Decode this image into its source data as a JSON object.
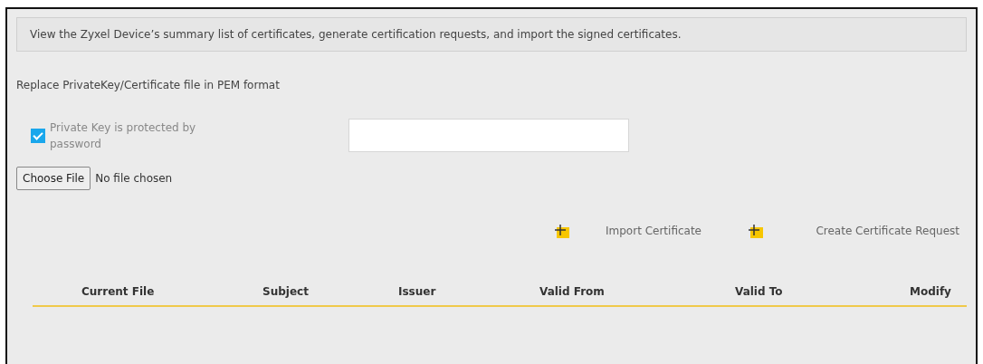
{
  "description": "View the Zyxel Device’s summary list of certificates, generate certification requests, and import the signed certificates.",
  "replace_heading": "Replace PrivateKey/Certificate file in PEM format",
  "password_protection": {
    "label": "Private Key is protected by password",
    "checked": true
  },
  "file_picker": {
    "button": "Choose File",
    "status": "No file chosen"
  },
  "actions": [
    {
      "label": "Import Certificate"
    },
    {
      "label": "Create Certificate Request"
    }
  ],
  "table": {
    "columns": [
      "Current File",
      "Subject",
      "Issuer",
      "Valid From",
      "Valid To",
      "Modify"
    ]
  }
}
